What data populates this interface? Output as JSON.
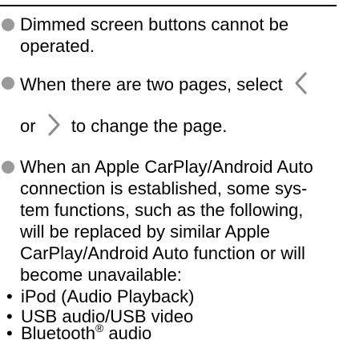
{
  "notes": {
    "item1": {
      "line1": "Dimmed screen buttons cannot be",
      "line2": "operated."
    },
    "item2": {
      "line1_text": "When there are two pages, select",
      "line2_before": "or",
      "line2_after": "to change the page.",
      "prev_icon": "chevron-left-icon",
      "next_icon": "chevron-right-icon"
    },
    "item3": {
      "lines": [
        "When an Apple CarPlay/Android Auto",
        "connection is established, some sys-",
        "tem functions, such as the following,",
        "will be replaced by similar Apple",
        "CarPlay/Android Auto function or will",
        "become unavailable:"
      ],
      "sub_mark": "•",
      "sub_items": [
        "iPod (Audio Playback)",
        "USB audio/USB video"
      ],
      "bluetooth": {
        "name": "Bluetooth",
        "reg": "®",
        "rest": " audio"
      }
    }
  },
  "colors": {
    "bullet": "#9a9a9a",
    "chevron": "#8a8a8a",
    "rule": "#000000"
  }
}
